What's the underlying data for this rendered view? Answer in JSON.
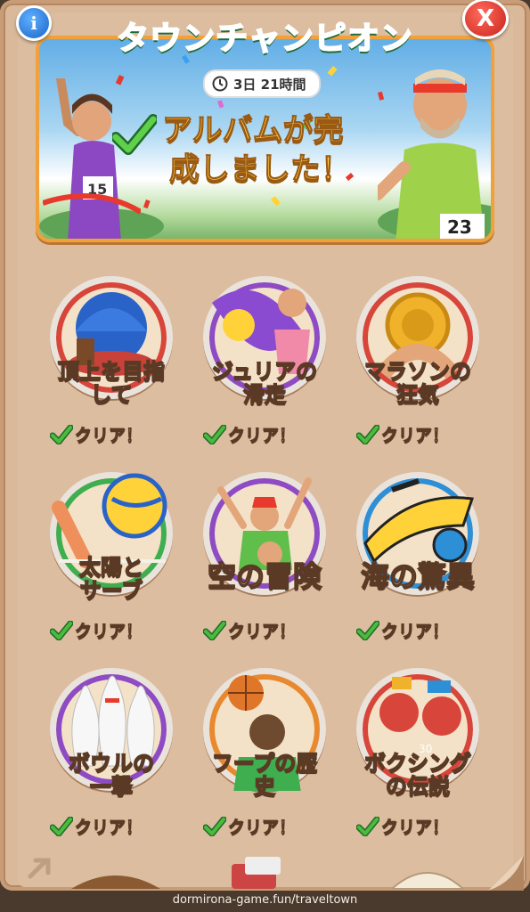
{
  "header": {
    "title": "タウンチャンピオン",
    "info_icon": "info-icon",
    "close_icon": "close-icon",
    "info_glyph": "i",
    "close_glyph": "X"
  },
  "banner": {
    "timer": "3日 21時間",
    "completed_text": "アルバムが完成しました！",
    "completed_line1": "アルバムが完",
    "completed_line2": "成しました！",
    "left_bib": "15",
    "right_bib": "23"
  },
  "albums": [
    {
      "label": "頂上を目指して",
      "line1": "頂上を目指",
      "line2": "して",
      "status": "クリア！",
      "ring_color": "#d8453a"
    },
    {
      "label": "ジュリアの滑走",
      "line1": "ジュリアの",
      "line2": "滑走",
      "status": "クリア！",
      "ring_color": "#8e4bc4"
    },
    {
      "label": "マラソンの狂気",
      "line1": "マラソンの",
      "line2": "狂気",
      "status": "クリア！",
      "ring_color": "#d8453a"
    },
    {
      "label": "太陽とサーブ",
      "line1": "太陽と",
      "line2": "サーブ",
      "status": "クリア！",
      "ring_color": "#3fae4f"
    },
    {
      "label": "空の冒険",
      "line1": "空の冒険",
      "line2": "",
      "status": "クリア！",
      "ring_color": "#8e4bc4"
    },
    {
      "label": "海の驚異",
      "line1": "海の驚異",
      "line2": "",
      "status": "クリア！",
      "ring_color": "#2d8fd6"
    },
    {
      "label": "ボウルの一撃",
      "line1": "ボウルの",
      "line2": "一撃",
      "status": "クリア！",
      "ring_color": "#8e4bc4"
    },
    {
      "label": "フープの歴史",
      "line1": "フープの歴",
      "line2": "史",
      "status": "クリア！",
      "ring_color": "#e8892f"
    },
    {
      "label": "ボクシングの伝説",
      "line1": "ボクシング",
      "line2": "の伝説",
      "status": "クリア！",
      "ring_color": "#d8453a"
    }
  ],
  "footer": {
    "url": "dormirona-game.fun/traveltown"
  },
  "colors": {
    "panel": "#dcbda0",
    "title_green": "#3fb46a",
    "banner_border": "#f0a13b",
    "check_green": "#4cbb3c"
  }
}
